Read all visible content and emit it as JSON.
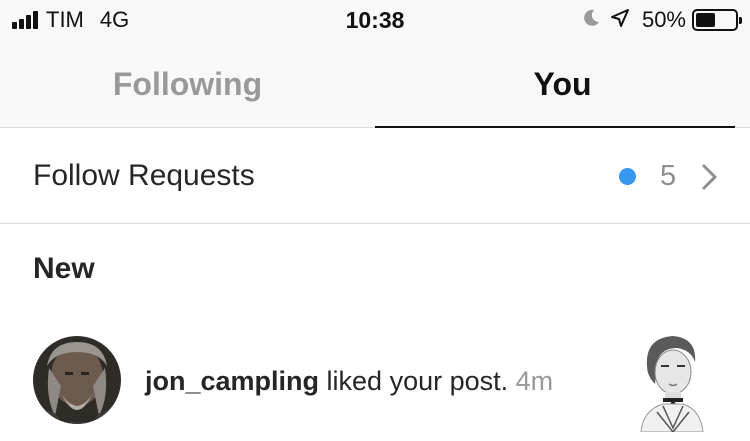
{
  "status_bar": {
    "carrier": "TIM",
    "network": "4G",
    "time": "10:38",
    "battery_percent": "50%",
    "battery_level": 0.5,
    "icons": [
      "signal-icon",
      "moon-icon",
      "location-arrow-icon",
      "battery-icon"
    ]
  },
  "tabs": {
    "following": "Following",
    "you": "You",
    "active": "You"
  },
  "follow_requests": {
    "label": "Follow Requests",
    "count": "5",
    "dot_color": "#3897f0"
  },
  "section": {
    "new_label": "New"
  },
  "activity": [
    {
      "username": "jon_campling",
      "action": " liked your post.",
      "time": "4m"
    }
  ],
  "colors": {
    "accent_blue": "#3897f0",
    "muted_text": "#999999",
    "divider": "#dbdbdb"
  }
}
